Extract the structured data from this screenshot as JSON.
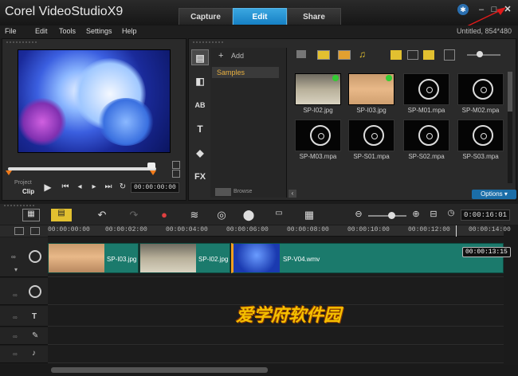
{
  "app": {
    "title_brand": "Corel VideoStudio",
    "title_version": "X9"
  },
  "mode_tabs": [
    {
      "label": "Capture"
    },
    {
      "label": "Edit"
    },
    {
      "label": "Share"
    }
  ],
  "window_controls": {
    "minimize": "–",
    "maximize": "□",
    "close": "✕"
  },
  "menu": [
    {
      "label": "File"
    },
    {
      "label": "Edit"
    },
    {
      "label": "Tools"
    },
    {
      "label": "Settings"
    },
    {
      "label": "Help"
    }
  ],
  "project_info": "Untitled, 854*480",
  "player": {
    "project_label": "Project",
    "clip_label": "Clip",
    "timecode": "00:00:00:00"
  },
  "library": {
    "add_label": "Add",
    "folder": "Samples",
    "browse_label": "Browse",
    "options_label": "Options",
    "icons": [
      "media-icon",
      "transition-icon",
      "title-ab-icon",
      "text-t-icon",
      "graphics-icon",
      "fx-icon"
    ],
    "fx_text": "FX",
    "ab_text": "AB",
    "t_text": "T",
    "items": [
      {
        "name": "SP-I02.jpg",
        "kind": "image",
        "checked": true
      },
      {
        "name": "SP-I03.jpg",
        "kind": "image",
        "checked": true
      },
      {
        "name": "SP-M01.mpa",
        "kind": "audio",
        "checked": false
      },
      {
        "name": "SP-M02.mpa",
        "kind": "audio",
        "checked": false
      },
      {
        "name": "SP-M03.mpa",
        "kind": "audio",
        "checked": false
      },
      {
        "name": "SP-S01.mpa",
        "kind": "audio",
        "checked": false
      },
      {
        "name": "SP-S02.mpa",
        "kind": "audio",
        "checked": false
      },
      {
        "name": "SP-S03.mpa",
        "kind": "audio",
        "checked": false
      }
    ]
  },
  "timeline": {
    "zoom_timecode": "0:00:16:01",
    "ruler": [
      "00:00:00:00",
      "00:00:02:00",
      "00:00:04:00",
      "00:00:06:00",
      "00:00:08:00",
      "00:00:10:00",
      "00:00:12:00",
      "00:00:14:00"
    ],
    "clips": [
      {
        "name": "SP-I03.jpg"
      },
      {
        "name": "SP-I02.jpg"
      },
      {
        "name": "SP-V04.wmv"
      }
    ],
    "tooltip_time": "00:00:13:15"
  },
  "watermark": "爱学府软件园"
}
